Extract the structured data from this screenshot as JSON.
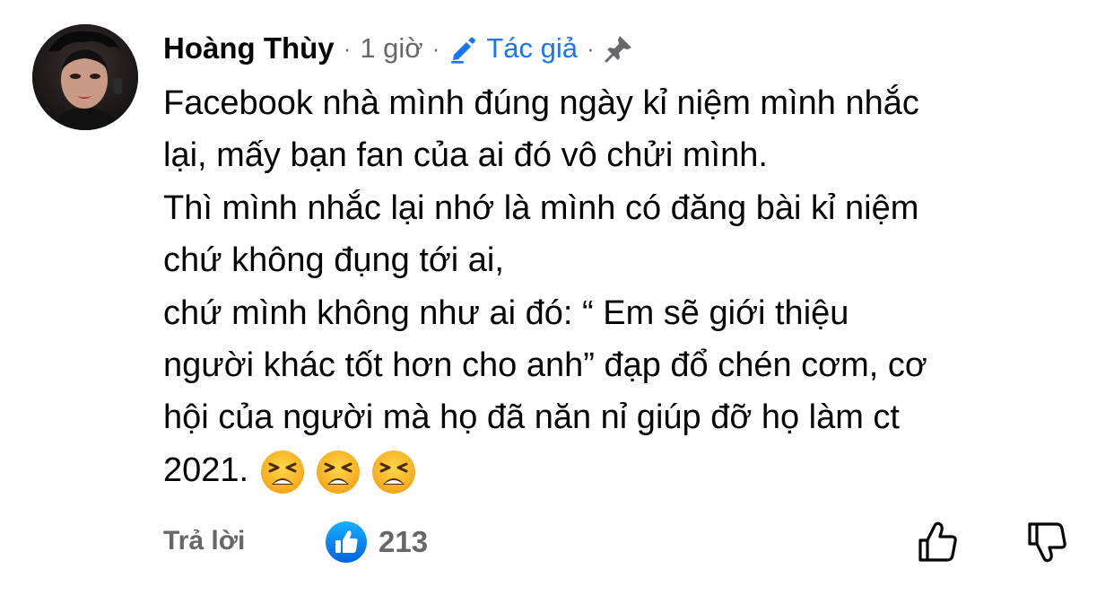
{
  "comment": {
    "author": "Hoàng Thùy",
    "separator": "·",
    "timestamp": "1 giờ",
    "author_badge": "Tác giả",
    "lines": [
      "Facebook nhà mình đúng ngày kỉ niệm mình nhắc",
      "lại, mấy bạn fan của ai đó vô chửi mình.",
      "Thì mình nhắc lại nhớ là mình có đăng bài kỉ niệm",
      "chứ không đụng tới ai,",
      "chứ mình không như ai đó: “ Em sẽ giới thiệu",
      "người khác tốt hơn cho anh” đạp đổ chén cơm, cơ",
      "hội của người  mà họ đã năn nỉ giúp đỡ họ làm ct",
      "2021."
    ],
    "emojis": [
      "tired-face-emoji",
      "tired-face-emoji",
      "tired-face-emoji"
    ]
  },
  "footer": {
    "reply_label": "Trả lời",
    "like_count": "213"
  },
  "icons": {
    "author_badge": "pencil-icon",
    "pin": "pin-icon",
    "like_reaction": "like-reaction-icon",
    "upvote": "thumbs-up-outline-icon",
    "downvote": "thumbs-down-outline-icon"
  },
  "colors": {
    "text": "#050505",
    "secondary": "#65676b",
    "accent": "#1877f2"
  }
}
